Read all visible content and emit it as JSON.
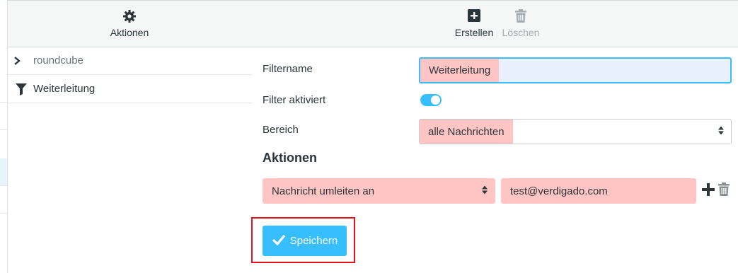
{
  "left_toolbar": {
    "actions_label": "Aktionen",
    "actions_icon": "gear-icon"
  },
  "filter_sets": [
    {
      "label": "roundcube",
      "icon": "chevron-right-icon"
    },
    {
      "label": "Weiterleitung",
      "icon": "filter-icon"
    }
  ],
  "right_toolbar": {
    "create_label": "Erstellen",
    "create_icon": "plus-square-icon",
    "delete_label": "Löschen",
    "delete_icon": "trash-icon"
  },
  "form": {
    "filtername_label": "Filtername",
    "filtername_value": "Weiterleitung",
    "enabled_label": "Filter aktiviert",
    "enabled": true,
    "scope_label": "Bereich",
    "scope_value": "alle Nachrichten",
    "actions_title": "Aktionen",
    "action_type": "Nachricht umleiten an",
    "action_target": "test@verdigado.com",
    "save_label": "Speichern"
  },
  "colors": {
    "accent": "#37beff",
    "highlight": "#ffc4c4",
    "annotation": "#e3131b"
  }
}
